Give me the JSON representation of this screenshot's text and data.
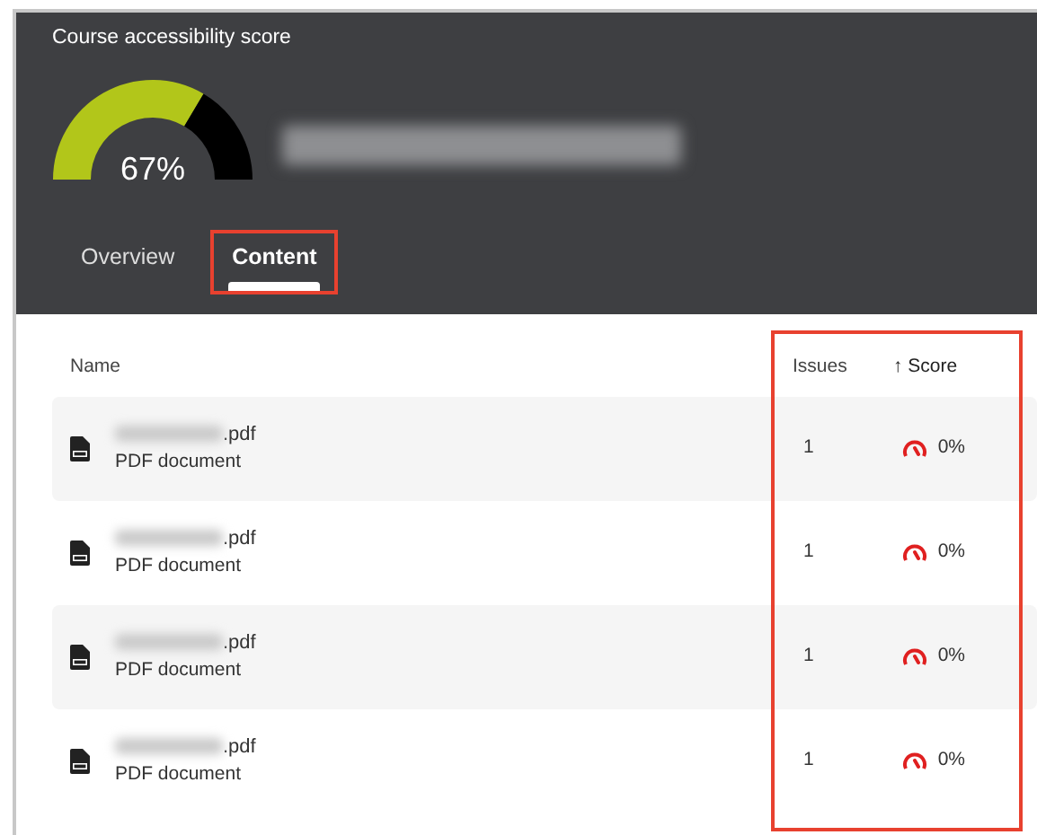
{
  "header": {
    "title": "Course accessibility score",
    "score": "67%",
    "course_name_blurred": true
  },
  "tabs": [
    {
      "label": "Overview",
      "selected": false,
      "highlighted": false
    },
    {
      "label": "Content",
      "selected": true,
      "highlighted": true
    }
  ],
  "table": {
    "columns": [
      {
        "label": "Name"
      },
      {
        "label": "Issues"
      },
      {
        "label": "Score",
        "sort_arrow": "↑"
      }
    ],
    "score_columns_highlighted": true,
    "rows": [
      {
        "name": ".pdf",
        "name_blurred": true,
        "type": "PDF document",
        "issues": "1",
        "score": "0%"
      },
      {
        "name": ".pdf",
        "name_blurred": true,
        "type": "PDF document",
        "issues": "1",
        "score": "0%"
      },
      {
        "name": ".pdf",
        "name_blurred": true,
        "type": "PDF document",
        "issues": "1",
        "score": "0%"
      },
      {
        "name": ".pdf",
        "name_blurred": true,
        "type": "PDF document",
        "issues": "1",
        "score": "0%"
      }
    ]
  }
}
